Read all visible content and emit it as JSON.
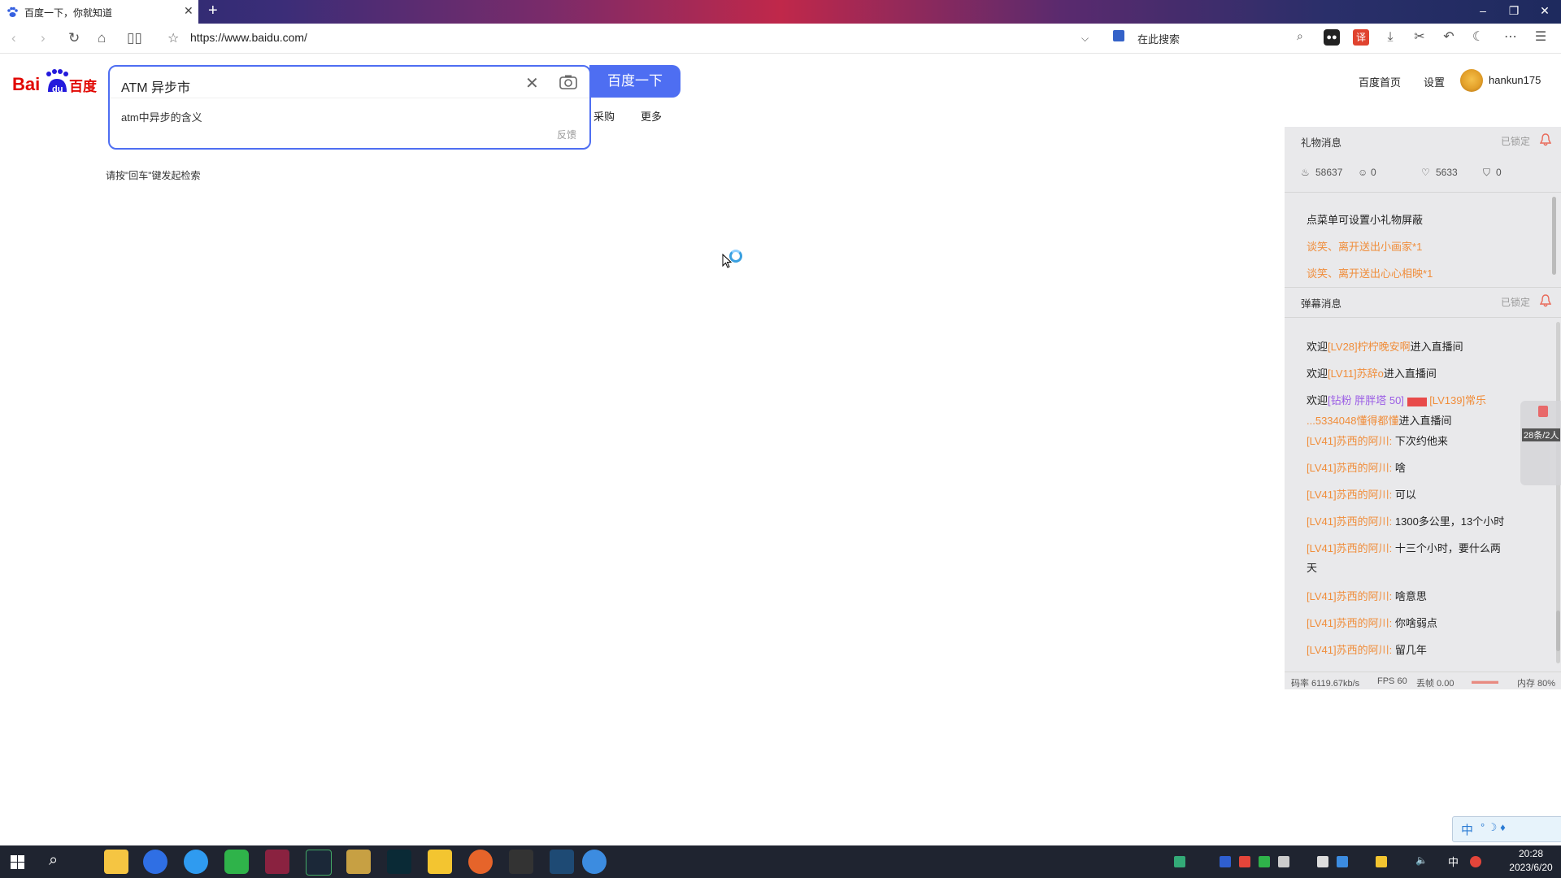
{
  "browser": {
    "tab_title": "百度一下，你就知道",
    "url": "https://www.baidu.com/",
    "search_placeholder": "在此搜索"
  },
  "baidu": {
    "logo_text": "Bai百度",
    "query": "ATM 异步市",
    "suggestion": "atm中异步的含义",
    "feedback": "反馈",
    "search_button": "百度一下",
    "nav_links": [
      "采购",
      "更多"
    ],
    "hint": "请按\"回车\"键发起检索",
    "top_links": [
      "百度首页",
      "设置"
    ],
    "username": "hankun175"
  },
  "live_panel": {
    "gift_header": "礼物消息",
    "gift_locked": "已锁定",
    "stats": [
      "58637",
      "0",
      "5633",
      "0"
    ],
    "gift_messages": [
      {
        "text": "点菜单可设置小礼物屏蔽"
      },
      {
        "user": "谈笑、离开",
        "mid": "送出",
        "gift": "小画家*1"
      },
      {
        "user": "谈笑、离开",
        "mid": "送出",
        "gift": "心心相映*1"
      }
    ],
    "danmu_header": "弹幕消息",
    "danmu_locked": "已锁定",
    "entries": [
      {
        "pre": "欢迎",
        "lv": "[LV28]",
        "name": "柠柠晚安啊",
        "post": "进入直播间"
      },
      {
        "pre": "欢迎",
        "lv": "[LV11]",
        "name": "苏辞o",
        "post": "进入直播间"
      },
      {
        "pre": "欢迎",
        "badge": "[钻粉 胖胖塔 50]",
        "lv2": "[LV139]",
        "name": "常乐",
        "line2_name": "...5334048懂得都懂",
        "post": "进入直播间"
      }
    ],
    "side_badge": "28条/2人",
    "chats": [
      {
        "lv": "[LV41]",
        "name": "苏西的阿川:",
        "text": "下次约他来"
      },
      {
        "lv": "[LV41]",
        "name": "苏西的阿川:",
        "text": "啥"
      },
      {
        "lv": "[LV41]",
        "name": "苏西的阿川:",
        "text": "可以"
      },
      {
        "lv": "[LV41]",
        "name": "苏西的阿川:",
        "text": "1300多公里，13个小时"
      },
      {
        "lv": "[LV41]",
        "name": "苏西的阿川:",
        "text": "十三个小时，要什么两",
        "cont": "天"
      },
      {
        "lv": "[LV41]",
        "name": "苏西的阿川:",
        "text": "啥意思"
      },
      {
        "lv": "[LV41]",
        "name": "苏西的阿川:",
        "text": "你啥弱点"
      },
      {
        "lv": "[LV41]",
        "name": "苏西的阿川:",
        "text": "留几年"
      }
    ],
    "footer": {
      "bitrate": "码率 6119.67kb/s",
      "fps": "FPS 60",
      "drop": "丢帧 0.00",
      "mem": "内存 80%"
    }
  },
  "taskbar": {
    "time": "20:28",
    "date": "2023/6/20",
    "ime_label": "中"
  }
}
